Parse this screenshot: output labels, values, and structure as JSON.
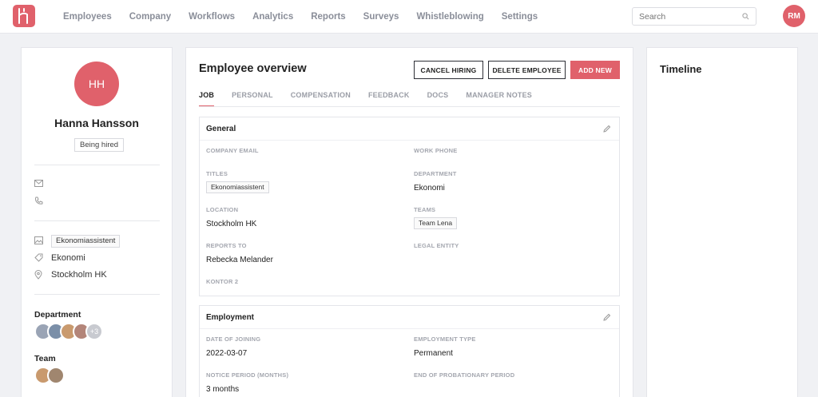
{
  "nav": {
    "items": [
      "Employees",
      "Company",
      "Workflows",
      "Analytics",
      "Reports",
      "Surveys",
      "Whistleblowing",
      "Settings"
    ],
    "search_placeholder": "Search",
    "user_initials": "RM"
  },
  "profile": {
    "initials": "HH",
    "name": "Hanna Hansson",
    "status": "Being hired",
    "title": "Ekonomiassistent",
    "department": "Ekonomi",
    "location": "Stockholm HK",
    "department_heading": "Department",
    "department_more": "+3",
    "team_heading": "Team"
  },
  "overview": {
    "title": "Employee overview",
    "cancel_label": "CANCEL HIRING",
    "delete_label": "DELETE EMPLOYEE",
    "add_label": "ADD NEW",
    "tabs": [
      "JOB",
      "PERSONAL",
      "COMPENSATION",
      "FEEDBACK",
      "DOCS",
      "MANAGER NOTES"
    ]
  },
  "general": {
    "title": "General",
    "company_email_label": "COMPANY EMAIL",
    "work_phone_label": "WORK PHONE",
    "titles_label": "TITLES",
    "titles_value": "Ekonomiassistent",
    "department_label": "DEPARTMENT",
    "department_value": "Ekonomi",
    "location_label": "LOCATION",
    "location_value": "Stockholm HK",
    "teams_label": "TEAMS",
    "teams_value": "Team Lena",
    "reports_to_label": "REPORTS TO",
    "reports_to_value": "Rebecka Melander",
    "legal_entity_label": "LEGAL ENTITY",
    "kontor_label": "KONTOR 2"
  },
  "employment": {
    "title": "Employment",
    "date_label": "DATE OF JOINING",
    "date_value": "2022-03-07",
    "type_label": "EMPLOYMENT TYPE",
    "type_value": "Permanent",
    "notice_label": "NOTICE PERIOD (MONTHS)",
    "notice_value": "3 months",
    "probation_label": "END OF PROBATIONARY PERIOD"
  },
  "timeline": {
    "title": "Timeline"
  },
  "colors": {
    "accent": "#e0616b"
  }
}
